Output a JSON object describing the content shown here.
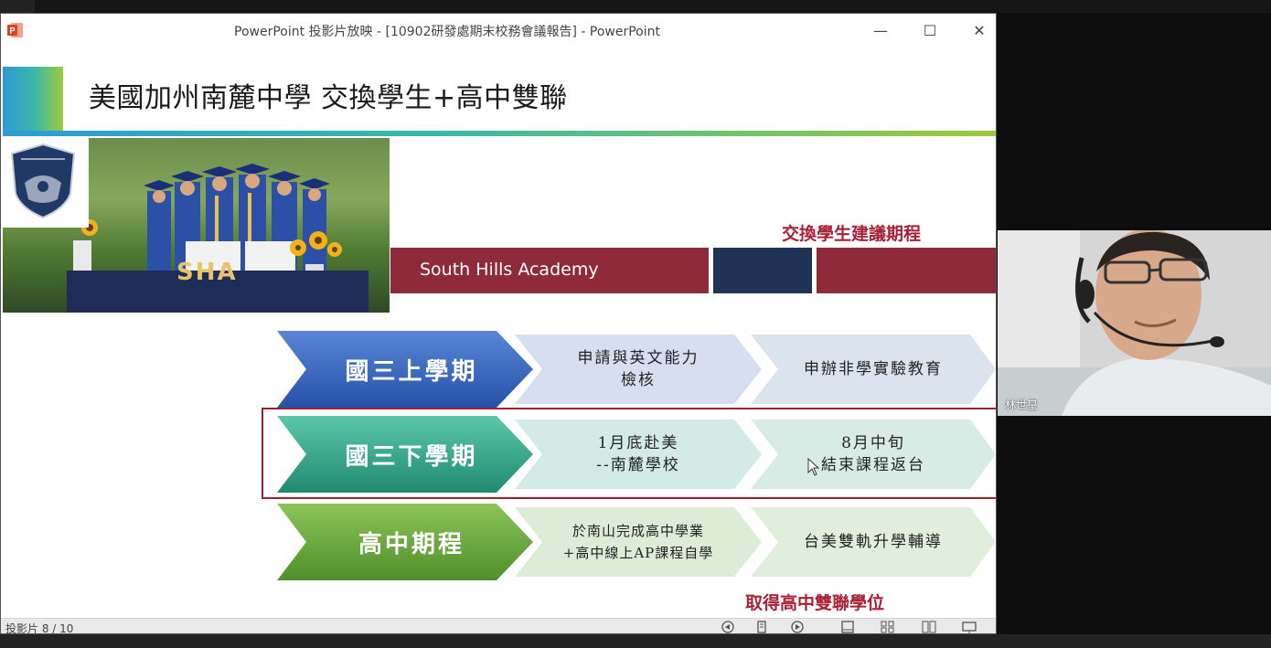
{
  "window": {
    "title": "PowerPoint 投影片放映 - [10902研發處期末校務會議報告] - PowerPoint",
    "minimize_symbol": "—",
    "maximize_symbol": "☐",
    "close_symbol": "✕"
  },
  "slide": {
    "title": "美國加州南麓中學 交換學生+高中雙聯",
    "suggest_label": "交換學生建議期程",
    "bar_label": "South Hills Academy",
    "photo_sign": "SHA",
    "rows": [
      {
        "term": "國三上學期",
        "step1": [
          "申請與英文能力",
          "檢核"
        ],
        "step2": [
          "申辦非學實驗教育"
        ]
      },
      {
        "term": "國三下學期",
        "step1": [
          "1月底赴美",
          "--南麓學校"
        ],
        "step2": [
          "8月中旬",
          "結束課程返台"
        ]
      },
      {
        "term": "高中期程",
        "step1": [
          "於南山完成高中學業",
          "+高中線上AP課程自學"
        ],
        "step2": [
          "台美雙軌升學輔導"
        ]
      }
    ],
    "result_label": "取得高中雙聯學位"
  },
  "status": {
    "slide_counter": "投影片 8 / 10"
  },
  "webcam": {
    "participant_name": "林世皇"
  },
  "colors": {
    "maroon": "#8f2a3a",
    "navy": "#1e3355",
    "blue_arrow": "#2f64c0",
    "teal_arrow": "#2aa38a",
    "green_arrow": "#63a53a",
    "label_red": "#a72236"
  }
}
